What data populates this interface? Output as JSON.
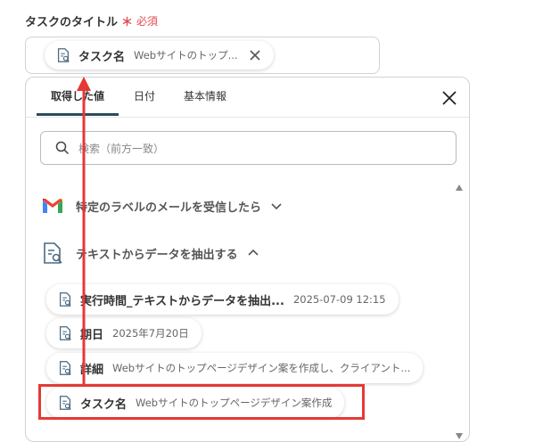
{
  "field": {
    "label": "タスクのタイトル",
    "required_mark": "＊",
    "required_text": "必須",
    "chip": {
      "name": "タスク名",
      "value": "Webサイトのトップ..."
    }
  },
  "panel": {
    "tabs": [
      {
        "label": "取得した値",
        "active": true
      },
      {
        "label": "日付",
        "active": false
      },
      {
        "label": "基本情報",
        "active": false
      }
    ],
    "search": {
      "placeholder": "検索（前方一致）",
      "value": ""
    },
    "sections": [
      {
        "title": "特定のラベルのメールを受信したら",
        "icon": "gmail-icon",
        "expanded": false
      },
      {
        "title": "テキストからデータを抽出する",
        "icon": "document-search-icon",
        "expanded": true
      }
    ],
    "items": [
      {
        "name": "実行時間_テキストからデータを抽出...",
        "value": "2025-07-09 12:15"
      },
      {
        "name": "期日",
        "value": "2025年7月20日"
      },
      {
        "name": "詳細",
        "value": "Webサイトのトップページデザイン案を作成し、クライアント..."
      },
      {
        "name": "タスク名",
        "value": "Webサイトのトップページデザイン案作成",
        "highlighted": true
      }
    ]
  },
  "colors": {
    "highlight": "#e53935",
    "tab_underline": "#2c4a5b",
    "required": "#e5484d"
  }
}
